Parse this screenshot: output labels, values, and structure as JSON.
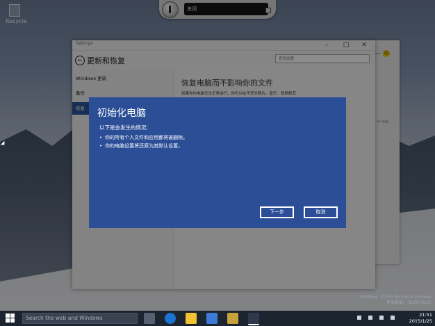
{
  "desktop": {
    "recycle_label": "Recycle"
  },
  "switcher": {
    "label": "关闭"
  },
  "back_window": {
    "tail_text": "IP 404"
  },
  "settings": {
    "window_title": "Settings",
    "header_title": "更新和恢复",
    "search_placeholder": "查找设置",
    "sidebar": [
      {
        "label": "Windows 更新",
        "active": false
      },
      {
        "label": "备份",
        "active": false
      },
      {
        "label": "恢复",
        "active": true
      }
    ],
    "main_heading": "恢复电脑而不影响你的文件",
    "main_text": "如果你的电脑无法正常运行，你可以在不丢失照片、音乐、视频和其"
  },
  "dialog": {
    "title": "初始化电脑",
    "description": "以下是会发生的情况:",
    "bullets": [
      "你的所有个人文件和应用都将被删除。",
      "你的电脑设置将还原为其默认设置。"
    ],
    "next_label": "下一步",
    "cancel_label": "取消"
  },
  "watermark": {
    "line1": "Windows 10 Pro Technical Preview",
    "line2": "评估副本。 Build 9926"
  },
  "taskbar": {
    "search_placeholder": "Search the web and Windows",
    "time": "21:51",
    "date": "2015/1/25"
  }
}
